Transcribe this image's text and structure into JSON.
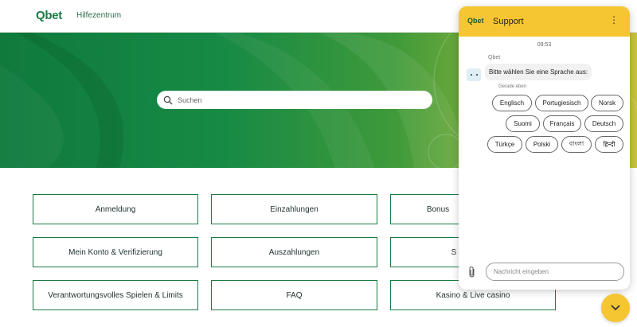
{
  "header": {
    "logo": "Qbet",
    "help_link": "Hilfezentrum"
  },
  "hero": {
    "search_placeholder": "Suchen"
  },
  "categories": [
    "Anmeldung",
    "Einzahlungen",
    "Bonus",
    "Mein Konto & Verifizierung",
    "Auszahlungen",
    "S",
    "Verantwortungsvolles Spielen & Limits",
    "FAQ",
    "Kasino & Live casino"
  ],
  "chat": {
    "logo": "Qbet",
    "title": "Support",
    "menu_icon": "⋮",
    "time": "09:53",
    "bot_name": "Qbet",
    "message": "Bitte wählen Sie eine Sprache aus:",
    "message_time": "Gerade eben",
    "languages": [
      "Englisch",
      "Portugiesisch",
      "Norsk",
      "Suomi",
      "Français",
      "Deutsch",
      "Türkçe",
      "Polski",
      "বাংলা",
      "हिन्दी"
    ],
    "input_placeholder": "Nachricht eingeben",
    "colors": {
      "accent": "#f6c632",
      "brand": "#1d7a44"
    }
  }
}
